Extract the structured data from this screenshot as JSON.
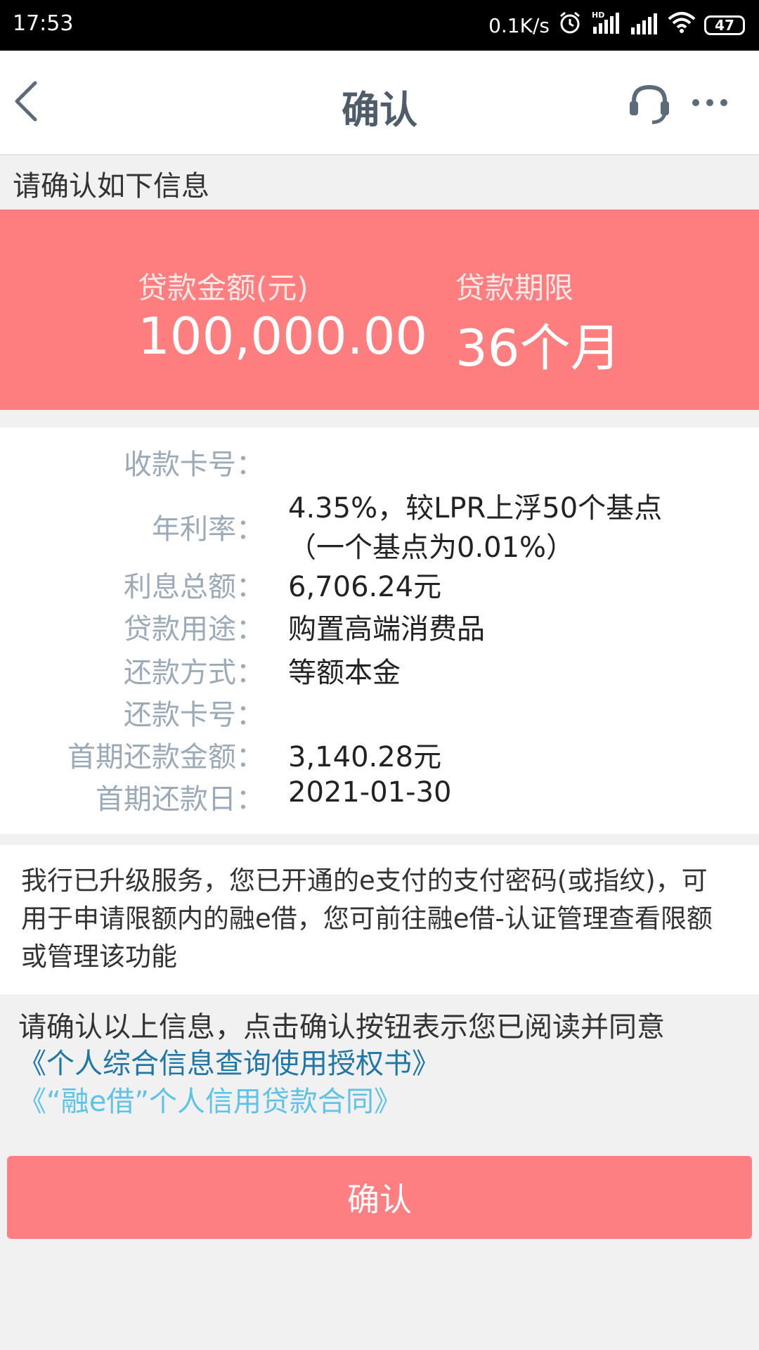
{
  "status_bar": {
    "time": "17:53",
    "network_speed": "0.1K/s",
    "hd_label": "HD",
    "battery": "47",
    "icons": [
      "alarm-icon",
      "hd-signal-icon",
      "signal-icon",
      "wifi-icon",
      "battery-icon"
    ]
  },
  "nav": {
    "title": "确认",
    "icons": [
      "back-icon",
      "customer-service-icon",
      "more-icon"
    ]
  },
  "section_label": "请确认如下信息",
  "banner": {
    "amount_label": "贷款金额(元)",
    "amount_value": "100,000.00",
    "term_label": "贷款期限",
    "term_value": "36个月",
    "color": "#fe7d7f"
  },
  "details": [
    {
      "label": "收款卡号：",
      "value": ""
    },
    {
      "label": "年利率：",
      "value": "4.35%，较LPR上浮50个基点",
      "value_line2": "（一个基点为0.01%）"
    },
    {
      "label": "利息总额：",
      "value": "6,706.24元"
    },
    {
      "label": "贷款用途：",
      "value": "购置高端消费品"
    },
    {
      "label": "还款方式：",
      "value": "等额本金"
    },
    {
      "label": "还款卡号：",
      "value": ""
    },
    {
      "label": "首期还款金额：",
      "value": "3,140.28元"
    },
    {
      "label": "首期还款日：",
      "value": "2021-01-30"
    }
  ],
  "notice": "我行已升级服务，您已开通的e支付的支付密码(或指纹)，可用于申请限额内的融e借，您可前往融e借-认证管理查看限额或管理该功能",
  "agreement": {
    "text": "请确认以上信息，点击确认按钮表示您已阅读并同意",
    "link1": "《个人综合信息查询使用授权书》",
    "link2": "《“融e借”个人信用贷款合同》"
  },
  "confirm_button": "确认",
  "colors": {
    "accent": "#fe7d7f",
    "link_dark": "#1f77a8",
    "link_light": "#5fc3e8",
    "label_gray": "#9aaab8"
  }
}
